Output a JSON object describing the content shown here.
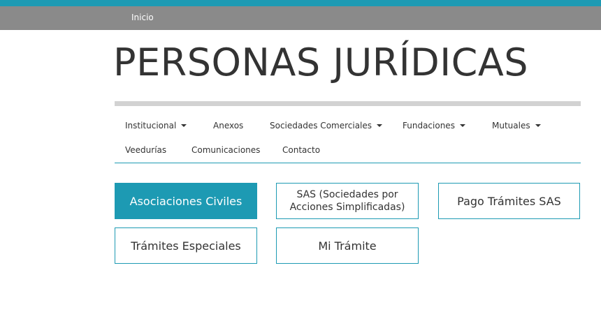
{
  "breadcrumb": {
    "label": "Inicio"
  },
  "page_title": "PERSONAS JURÍDICAS",
  "nav": {
    "institucional": "Institucional",
    "anexos": "Anexos",
    "sociedades": "Sociedades Comerciales",
    "fundaciones": "Fundaciones",
    "mutuales": "Mutuales",
    "veedurias": "Veedurías",
    "comunicaciones": "Comunicaciones",
    "contacto": "Contacto"
  },
  "tiles": {
    "asociaciones": "Asociaciones Civiles",
    "sas_line1": "SAS (Sociedades por",
    "sas_line2": "Acciones Simplificadas)",
    "pago_sas": "Pago Trámites SAS",
    "especiales": "Trámites Especiales",
    "mi_tramite": "Mi Trámite"
  },
  "colors": {
    "accent": "#1d9ab3",
    "breadcrumb_bar": "#8a8a8a",
    "rule": "#d2d2d2",
    "text": "#333333"
  }
}
